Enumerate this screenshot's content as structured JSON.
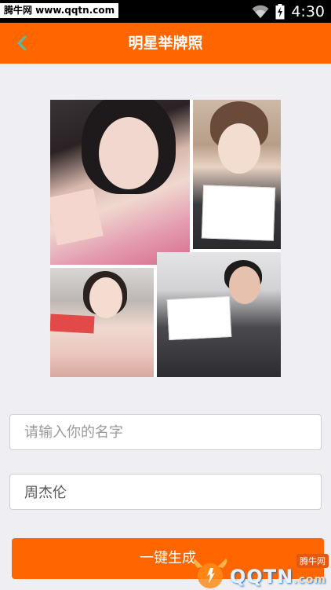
{
  "status_bar": {
    "watermark_badge": "腾牛网 www.qqtn.com",
    "time": "4:30",
    "icons": [
      "wifi-icon",
      "battery-icon"
    ]
  },
  "app_bar": {
    "title": "明星举牌照",
    "back_icon": "chevron-left-icon",
    "colors": {
      "bar": "#ff6600",
      "back_icon": "#4fc0a8"
    }
  },
  "collage": {
    "photo_count": 4
  },
  "form": {
    "name_input": {
      "placeholder": "请输入你的名字",
      "value": ""
    },
    "second_input": {
      "placeholder": "",
      "value": "周杰伦"
    },
    "generate_button": {
      "label": "一键生成"
    }
  },
  "watermark": {
    "brand": "QQTN",
    "suffix": ".com",
    "tag": "腾牛网"
  },
  "colors": {
    "accent": "#ff6600",
    "background": "#efeef3"
  }
}
